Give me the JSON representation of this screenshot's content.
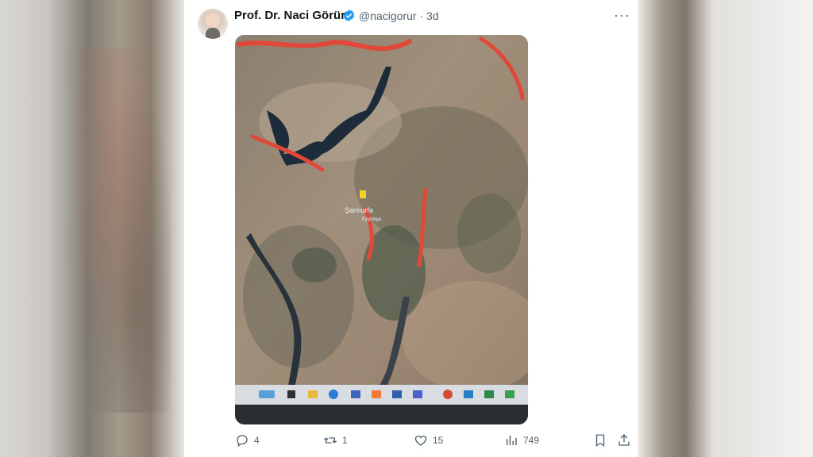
{
  "tweet": {
    "author_name": "Prof. Dr. Naci Görür",
    "handle": "@nacigorur",
    "separator": "·",
    "time": "3d",
    "more_label": "···",
    "verified_color": "#1d9bf0"
  },
  "map": {
    "labels": [
      "Şanlıurfa",
      "Eyyübiye"
    ]
  },
  "actions": {
    "replies": "4",
    "retweets": "1",
    "likes": "15",
    "views": "749"
  },
  "icons": [
    "reply-icon",
    "retweet-icon",
    "like-icon",
    "views-icon",
    "bookmark-icon",
    "share-icon",
    "verified-badge-icon",
    "more-icon"
  ]
}
